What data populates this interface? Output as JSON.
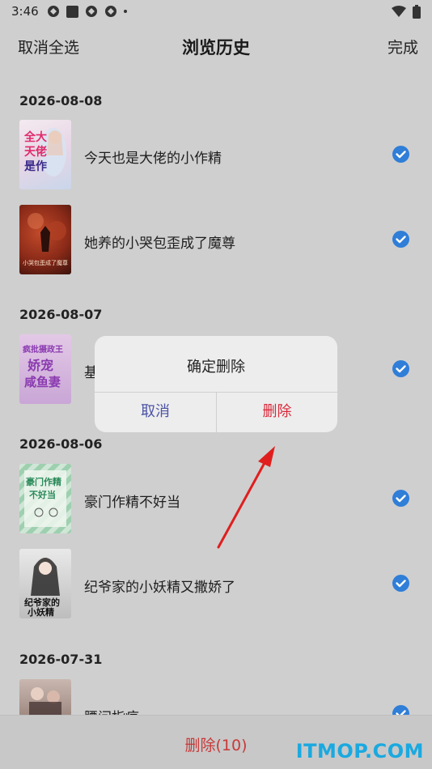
{
  "status_bar": {
    "time": "3:46"
  },
  "nav": {
    "left": "取消全选",
    "title": "浏览历史",
    "right": "完成"
  },
  "groups": [
    {
      "date": "2026-08-08",
      "items": [
        {
          "title": "今天也是大佬的小作精",
          "cover_text": "今天也是大佬的小作精"
        },
        {
          "title": "她养的小哭包歪成了魔尊",
          "cover_text": "小哭包歪成了魔尊"
        }
      ]
    },
    {
      "date": "2026-08-07",
      "items": [
        {
          "title": "基",
          "cover_text": "疯批摄政王娇宠咸鱼妻"
        }
      ]
    },
    {
      "date": "2026-08-06",
      "items": [
        {
          "title": "豪门作精不好当",
          "cover_text": "豪门作精不好当"
        },
        {
          "title": "纪爷家的小妖精又撒娇了",
          "cover_text": "纪爷家的小妖精"
        }
      ]
    },
    {
      "date": "2026-07-31",
      "items": [
        {
          "title": "腰间指痕",
          "cover_text": ""
        }
      ]
    }
  ],
  "dialog": {
    "title": "确定删除",
    "cancel": "取消",
    "confirm": "删除"
  },
  "bottom": {
    "delete_label": "删除(10)"
  },
  "watermark": "ITMOP.COM",
  "colors": {
    "accent_blue": "#2f7ed8",
    "delete_red": "#c83a3a",
    "dialog_delete": "#d8283a",
    "dialog_cancel": "#4b53a6",
    "watermark": "#1aa9e0"
  }
}
